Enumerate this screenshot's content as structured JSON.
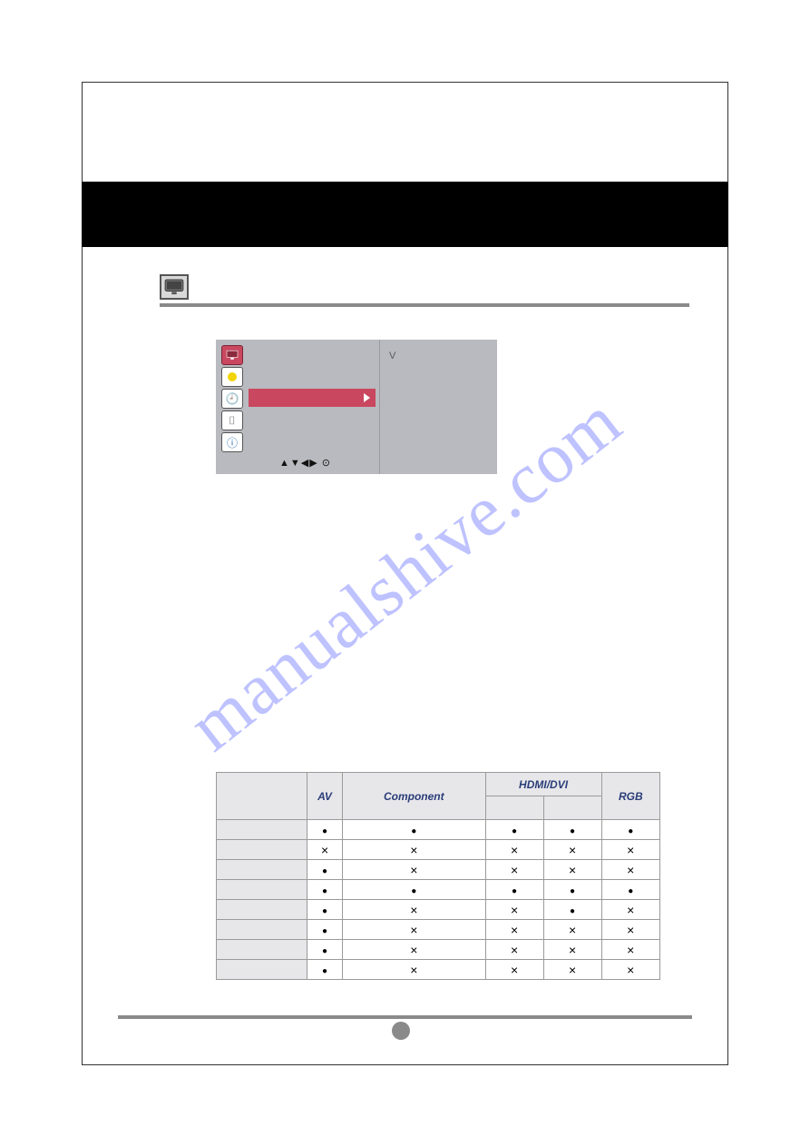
{
  "section": {
    "icon": "monitor-icon"
  },
  "osd": {
    "right_top_char": "V",
    "nav_glyphs": "▲▼◀▶ ⊙",
    "icons": [
      "monitor-icon",
      "record-dot-icon",
      "clock-icon",
      "toolbox-icon",
      "info-icon"
    ]
  },
  "table": {
    "headers": {
      "blank": "",
      "av": "AV",
      "component": "Component",
      "hdmi_dvi": "HDMI/DVI",
      "rgb": "RGB"
    },
    "rows": [
      {
        "label": "",
        "av": "dot",
        "comp": "dot",
        "hdmi_l": "dot",
        "hdmi_r": "dot",
        "rgb": "dot"
      },
      {
        "label": "",
        "av": "x",
        "comp": "x",
        "hdmi_l": "x",
        "hdmi_r": "x",
        "rgb": "x"
      },
      {
        "label": "",
        "av": "dot",
        "comp": "x",
        "hdmi_l": "x",
        "hdmi_r": "x",
        "rgb": "x"
      },
      {
        "label": "",
        "av": "dot",
        "comp": "dot",
        "hdmi_l": "dot",
        "hdmi_r": "dot",
        "rgb": "dot"
      },
      {
        "label": "",
        "av": "dot",
        "comp": "x",
        "hdmi_l": "x",
        "hdmi_r": "dot",
        "rgb": "x"
      },
      {
        "label": "",
        "av": "dot",
        "comp": "x",
        "hdmi_l": "x",
        "hdmi_r": "x",
        "rgb": "x"
      },
      {
        "label": "",
        "av": "dot",
        "comp": "x",
        "hdmi_l": "x",
        "hdmi_r": "x",
        "rgb": "x"
      },
      {
        "label": "",
        "av": "dot",
        "comp": "x",
        "hdmi_l": "x",
        "hdmi_r": "x",
        "rgb": "x"
      }
    ]
  },
  "watermark": "manualshive.com"
}
